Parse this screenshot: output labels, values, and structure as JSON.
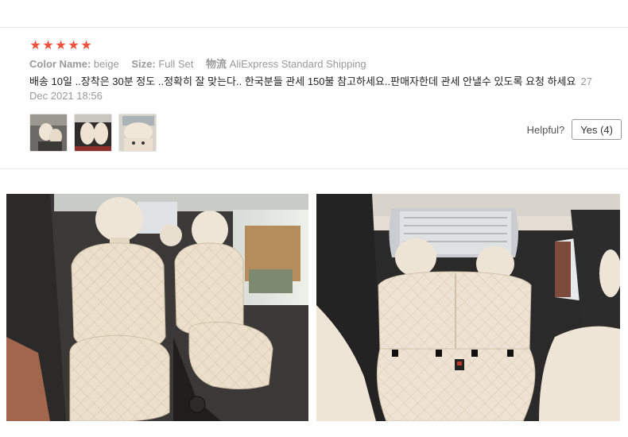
{
  "review": {
    "rating": 5,
    "color_name_label": "Color Name:",
    "color_name_value": "beige",
    "size_label": "Size:",
    "size_value": "Full Set",
    "shipping_label": "物流",
    "shipping_value": "AliExpress Standard Shipping",
    "text": "배송 10일 ..장착은 30분 정도 ..정확히 잘 맞는다.. 한국분들 관세 150불 참고하세요..판매자한데 관세 안낼수 있도록 요청 하세요",
    "date": "27 Dec 2021 18:56",
    "thumbnails": [
      "review-photo-1",
      "review-photo-2",
      "review-photo-3"
    ]
  },
  "helpful": {
    "label": "Helpful?",
    "yes_button": "Yes (4)"
  },
  "colors": {
    "star": "#f0503c",
    "seat_beige": "#efe3d2",
    "text_muted": "#999999"
  }
}
